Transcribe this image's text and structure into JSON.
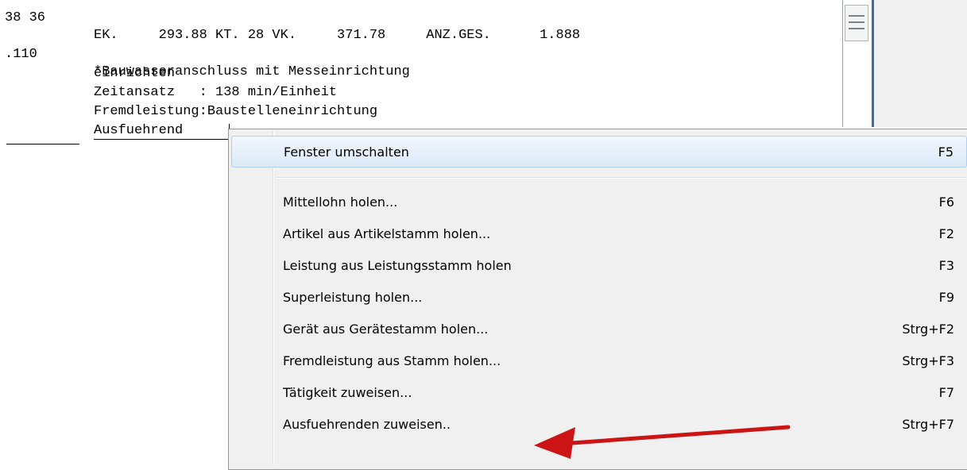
{
  "editor": {
    "lines": [
      {
        "num": "38 36",
        "text": "EK.     293.88 KT. 28 VK.     371.78     ANZ.GES.      1.888"
      },
      {
        "num": ".110",
        "text": "*Bauwasseranschluss mit Messeinrichtung"
      },
      {
        "num": "",
        "text": "einrichten"
      },
      {
        "num": "",
        "text": "Zeitansatz   : 138 min/Einheit"
      },
      {
        "num": "",
        "text": "Fremdleistung:Baustelleneinrichtung"
      },
      {
        "num": "",
        "text": "Ausfuehrend"
      }
    ]
  },
  "context_menu": {
    "items": [
      {
        "label": "Fenster umschalten",
        "shortcut": "F5"
      },
      {
        "label": "Mittellohn holen...",
        "shortcut": "F6"
      },
      {
        "label": "Artikel aus Artikelstamm holen...",
        "shortcut": "F2"
      },
      {
        "label": "Leistung aus Leistungsstamm holen",
        "shortcut": "F3"
      },
      {
        "label": "Superleistung holen...",
        "shortcut": "F9"
      },
      {
        "label": "Gerät aus Gerätestamm holen...",
        "shortcut": "Strg+F2"
      },
      {
        "label": "Fremdleistung aus Stamm holen...",
        "shortcut": "Strg+F3"
      },
      {
        "label": "Tätigkeit zuweisen...",
        "shortcut": "F7"
      },
      {
        "label": "Ausfuehrenden zuweisen..",
        "shortcut": "Strg+F7"
      }
    ]
  },
  "annotation": {
    "arrow_color": "#cc1414",
    "arrow_target": "Ausfuehrenden zuweisen.."
  },
  "colors": {
    "menu_bg": "#f0f0f0",
    "hover_bg": "#dbe9f8",
    "hover_border": "#aecff0",
    "scroll_accent": "#3c6ea0"
  }
}
